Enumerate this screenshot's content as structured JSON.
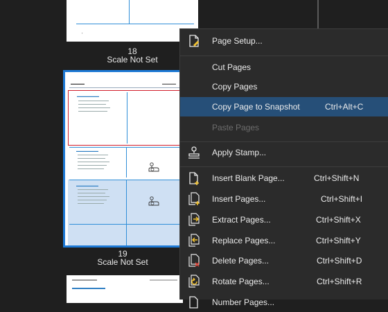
{
  "thumbnails": [
    {
      "page": "18",
      "status": "Scale Not Set"
    },
    {
      "page": "19",
      "status": "Scale Not Set",
      "selected": true
    }
  ],
  "context_menu": {
    "items": [
      {
        "label": "Page Setup...",
        "shortcut": "",
        "icon": "page-setup-icon"
      },
      {
        "label": "Cut Pages",
        "shortcut": ""
      },
      {
        "label": "Copy Pages",
        "shortcut": ""
      },
      {
        "label": "Copy Page to Snapshot",
        "shortcut": "Ctrl+Alt+C",
        "highlighted": true
      },
      {
        "label": "Paste Pages",
        "shortcut": "",
        "disabled": true
      },
      {
        "label": "Apply Stamp...",
        "shortcut": "",
        "icon": "stamp-icon"
      },
      {
        "label": "Insert Blank Page...",
        "shortcut": "Ctrl+Shift+N",
        "icon": "insert-blank-page-icon"
      },
      {
        "label": "Insert Pages...",
        "shortcut": "Ctrl+Shift+I",
        "icon": "insert-pages-icon"
      },
      {
        "label": "Extract Pages...",
        "shortcut": "Ctrl+Shift+X",
        "icon": "extract-pages-icon"
      },
      {
        "label": "Replace Pages...",
        "shortcut": "Ctrl+Shift+Y",
        "icon": "replace-pages-icon"
      },
      {
        "label": "Delete Pages...",
        "shortcut": "Ctrl+Shift+D",
        "icon": "delete-pages-icon"
      },
      {
        "label": "Rotate Pages...",
        "shortcut": "Ctrl+Shift+R",
        "icon": "rotate-pages-icon"
      },
      {
        "label": "Number Pages...",
        "shortcut": "",
        "icon": "number-pages-icon"
      }
    ]
  },
  "colors": {
    "highlight": "#264f78",
    "selection_border": "#1e7ad6",
    "menu_bg": "#2b2b2b",
    "panel_bg": "#1f1f1f"
  }
}
